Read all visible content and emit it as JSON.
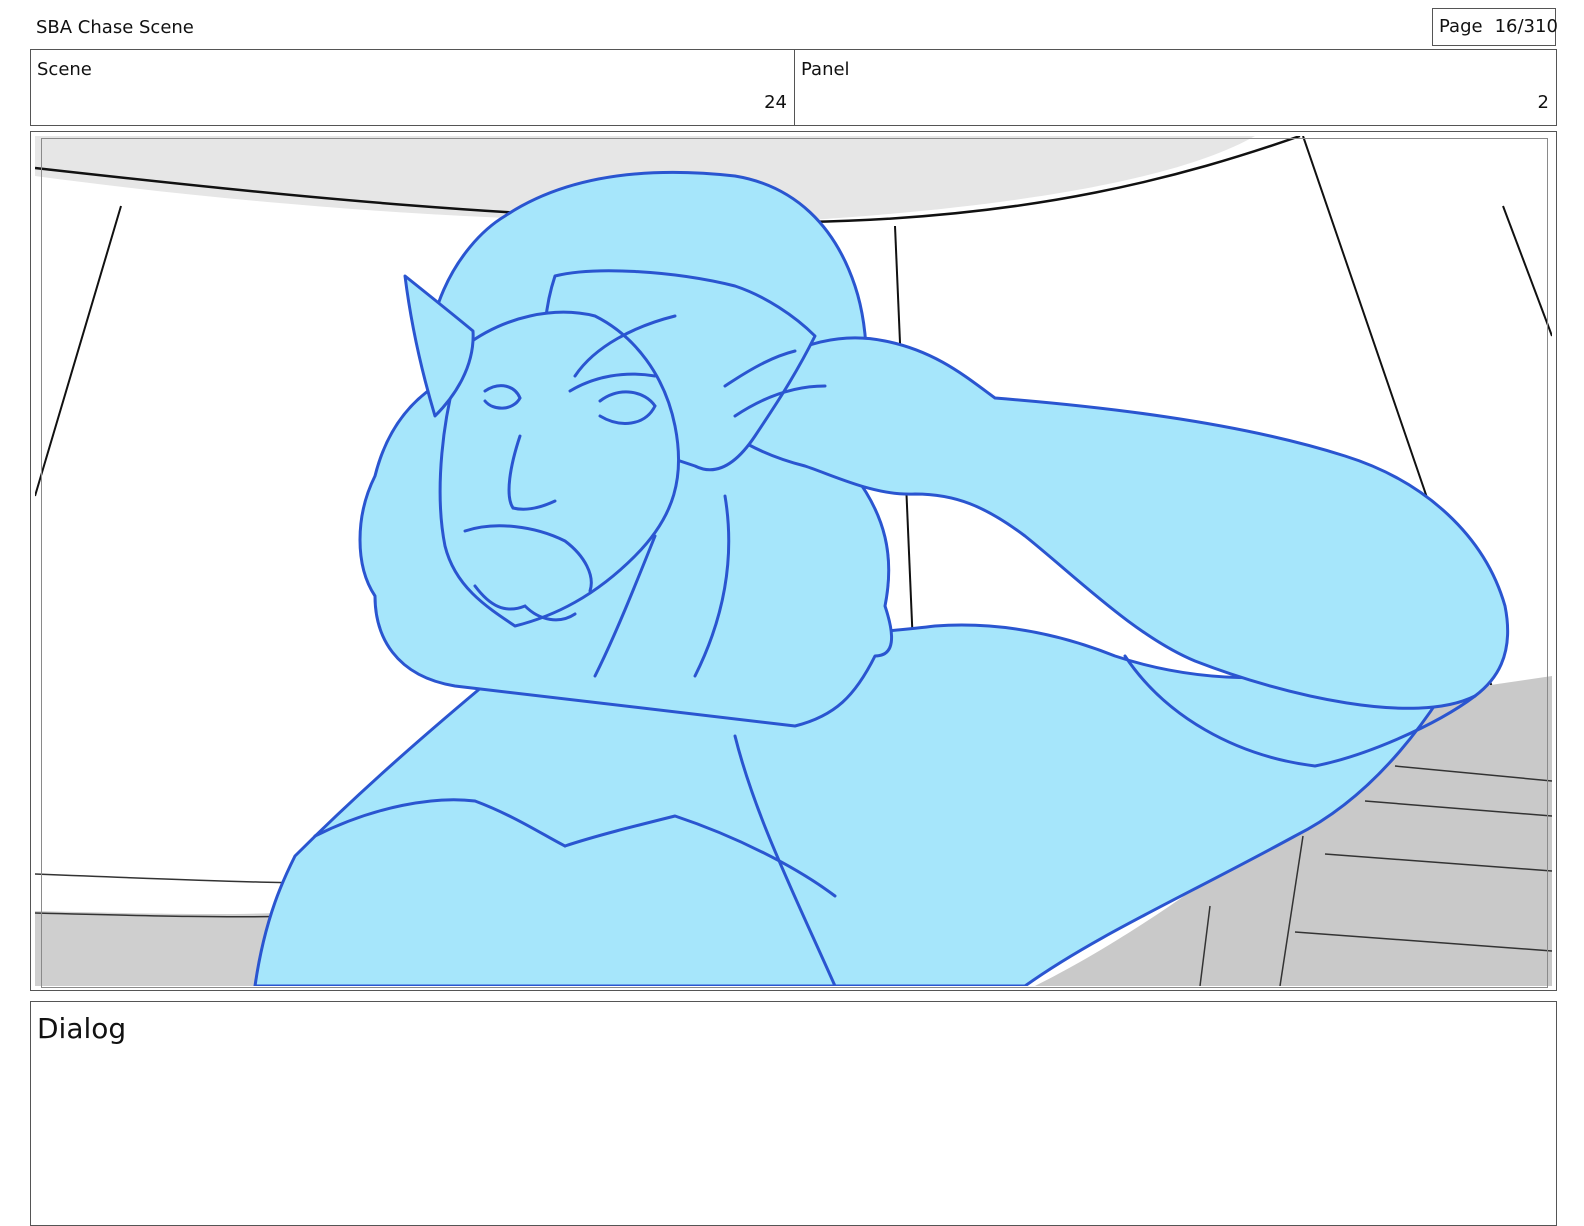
{
  "header": {
    "project_title": "SBA Chase Scene",
    "page_label": "Page",
    "page_number": "16/310"
  },
  "info": {
    "scene_label": "Scene",
    "scene_value": "24",
    "panel_label": "Panel",
    "panel_value": "2"
  },
  "dialog": {
    "label": "Dialog",
    "text": ""
  },
  "colors": {
    "figure_fill": "#a6e6fb",
    "figure_line": "#2a55d0",
    "background_line": "#111111",
    "floor_gray": "#c8c8c8",
    "ceiling_gray": "#e6e6e6"
  }
}
